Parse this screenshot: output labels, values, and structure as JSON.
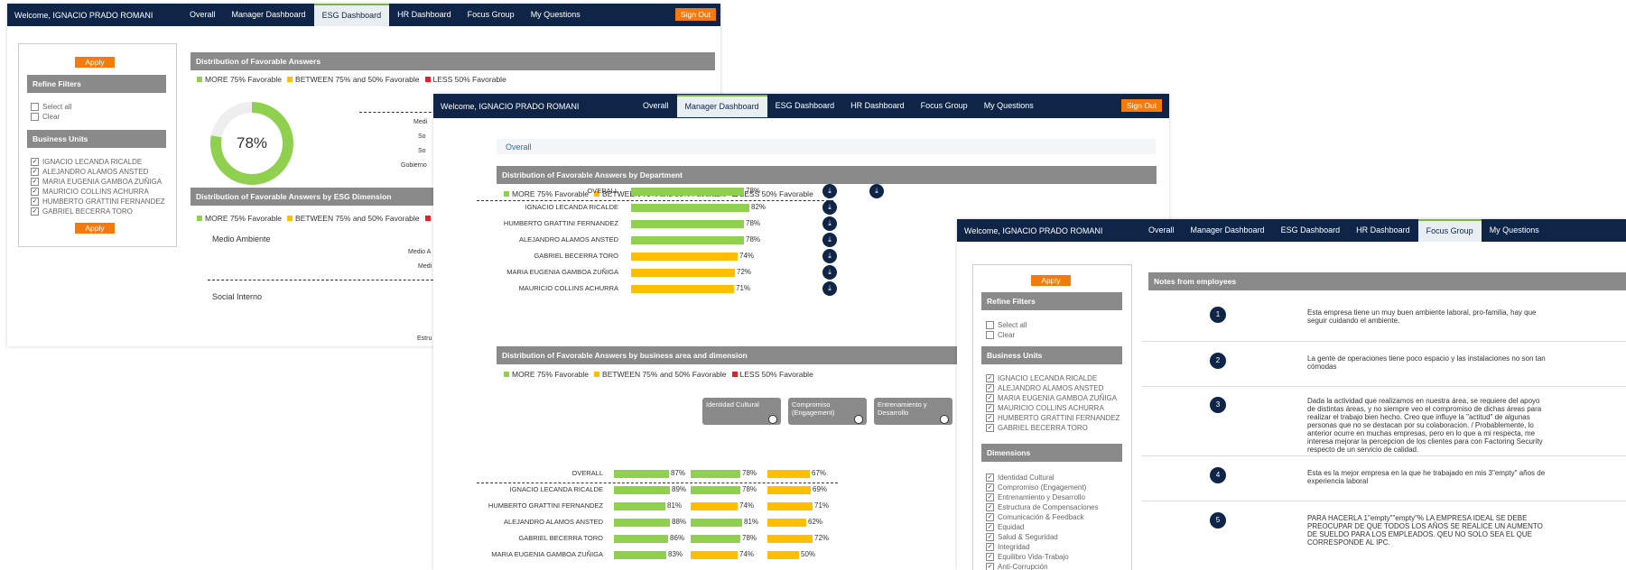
{
  "nav": {
    "welcome": "Welcome, IGNACIO PRADO ROMANI",
    "items": [
      "Overall",
      "Manager Dashboard",
      "ESG Dashboard",
      "HR Dashboard",
      "Focus Group",
      "My Questions"
    ],
    "signout": "Sign Out"
  },
  "colors": {
    "green": "#8fd14f",
    "orange": "#ffbf00",
    "red": "#ee1c25",
    "nav": "#0f2547",
    "accent": "#f47a0e"
  },
  "legend": {
    "more": "MORE 75% Favorable",
    "between": "BETWEEN 75% and 50% Favorable",
    "less": "LESS 50% Favorable"
  },
  "filters": {
    "apply": "Apply",
    "refine": "Refine Filters",
    "select_all": "Select all",
    "clear": "Clear",
    "business_units": "Business Units",
    "units": [
      "IGNACIO LECANDA RICALDE",
      "ALEJANDRO ALAMOS ANSTED",
      "MARIA EUGENIA GAMBOA ZUÑIGA",
      "MAURICIO COLLINS ACHURRA",
      "HUMBERTO GRATTINI FERNANDEZ",
      "GABRIEL BECERRA TORO"
    ],
    "dimensions": "Dimensions",
    "dimension_items": [
      "Identidad Cultural",
      "Compromiso (Engagement)",
      "Entrenamiento y Desarrollo",
      "Estructura de Compensaciones",
      "Comunicación & Feedback",
      "Equidad",
      "Salud & Seguridad",
      "Integridad",
      "Equilibro Vida-Trabajo",
      "Anti-Corrupción"
    ]
  },
  "esg": {
    "dist_title": "Distribution of Favorable Answers",
    "donut_value": "78%",
    "donut_fraction": 0.78,
    "dim_title": "Distribution of Favorable Answers by ESG Dimension",
    "dim_rows": [
      "Medio Ambiente",
      "Social Interno"
    ],
    "partial_labels": [
      "Medi",
      "So",
      "So",
      "Gobierno",
      "Medio A",
      "Medi",
      "Estru"
    ]
  },
  "manager": {
    "breadcrumb": "Overall",
    "dept_title": "Distribution of Favorable Answers by Department",
    "dept_rows": [
      {
        "label": "OVERALL",
        "value": 78
      },
      {
        "label": "IGNACIO LECANDA RICALDE",
        "value": 82
      },
      {
        "label": "HUMBERTO GRATTINI FERNANDEZ",
        "value": 78
      },
      {
        "label": "ALEJANDRO ALAMOS ANSTED",
        "value": 78
      },
      {
        "label": "GABRIEL BECERRA TORO",
        "value": 74
      },
      {
        "label": "MARIA EUGENIA GAMBOA ZUÑIGA",
        "value": 72
      },
      {
        "label": "MAURICIO COLLINS ACHURRA",
        "value": 71
      }
    ],
    "area_title": "Distribution of Favorable Answers by business area and dimension",
    "area_columns": [
      "Identidad Cultural",
      "Compromiso (Engagement)",
      "Entrenamiento y Desarrollo"
    ],
    "area_rows": [
      {
        "label": "OVERALL",
        "values": [
          87,
          78,
          67
        ]
      },
      {
        "label": "IGNACIO LECANDA RICALDE",
        "values": [
          89,
          78,
          69
        ]
      },
      {
        "label": "HUMBERTO GRATTINI FERNANDEZ",
        "values": [
          81,
          74,
          71
        ]
      },
      {
        "label": "ALEJANDRO ALAMOS ANSTED",
        "values": [
          88,
          81,
          62
        ]
      },
      {
        "label": "GABRIEL BECERRA TORO",
        "values": [
          86,
          78,
          72
        ]
      },
      {
        "label": "MARIA EUGENIA GAMBOA ZUÑIGA",
        "values": [
          83,
          74,
          50
        ]
      }
    ]
  },
  "focus": {
    "notes_title": "Notes from employees",
    "notes": [
      {
        "n": "1",
        "text": "Esta empresa tiene un muy buen ambiente laboral, pro-familia, hay que seguir cuidando el ambiente."
      },
      {
        "n": "2",
        "text": "La gente de operaciones tiene poco espacio y las instalaciones no son tan cómodas"
      },
      {
        "n": "3",
        "text": "Dada la actividad que realizamos en nuestra área, se requiere del apoyo de distintas áreas, y no siempre veo el compromiso de dichas áreas para realizar el trabajo bien hecho. Creo que influye la \"actitud\" de algunas personas que no se destacan por su colaboracion. / Probablemente, lo anterior ocurre en muchas empresas, pero en lo que a mi respecta, me interesa mejorar la percepcion de los clientes para con Factoring Security respecto de un servicio de calidad."
      },
      {
        "n": "4",
        "text": "Esta es la mejor empresa en la que he trabajado en mis 3\"empty\" años de experiencia laboral"
      },
      {
        "n": "5",
        "text": "PARA HACERLA 1\"empty\"\"empty\"% LA EMPRESA IDEAL SE DEBE PREOCUPAR DE QUE TODOS LOS AÑOS SE REALICE UN AUMENTO DE SUELDO PARA LOS EMPLEADOS. QEU NO SOLO SEA EL QUE CORRESPONDE AL IPC."
      }
    ]
  }
}
